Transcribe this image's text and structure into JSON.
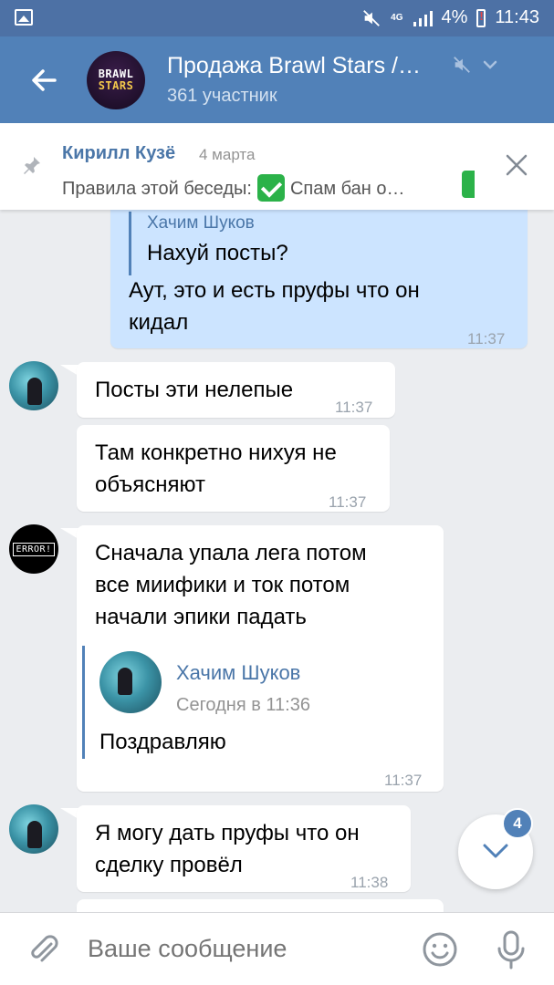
{
  "status_bar": {
    "network": "4G",
    "battery": "4%",
    "time": "11:43"
  },
  "header": {
    "title": "Продажа Brawl Stars /…",
    "subtitle": "361 участник",
    "avatar_logo": [
      "BRAWL",
      "STARS"
    ]
  },
  "pinned": {
    "author": "Кирилл Кузё",
    "date": "4 марта",
    "text_prefix": "Правила этой беседы:",
    "text_suffix": "Спам бан о…"
  },
  "messages": [
    {
      "quote_author": "Хачим Шуков",
      "quote_text": "Нахуй посты?",
      "line1": "Аут, это и есть пруфы что он",
      "line2": "кидал",
      "time": "11:37"
    },
    {
      "text": "Посты эти нелепые",
      "time": "11:37"
    },
    {
      "line1": "Там конкретно нихуя не",
      "line2": "объясняют",
      "time": "11:37"
    },
    {
      "line1": "Сначала упала лега потом",
      "line2": "все миифики и ток потом",
      "line3": "начали эпики падать",
      "quote_author": "Хачим Шуков",
      "quote_date": "Сегодня в 11:36",
      "quote_text": "Поздравляю",
      "time": "11:37",
      "avatar_text": "ERROR!"
    },
    {
      "line1": "Я могу дать пруфы что он",
      "line2": "сделку провёл",
      "time": "11:38"
    }
  ],
  "unread_badge": "4",
  "composer": {
    "placeholder": "Ваше сообщение"
  },
  "colors": {
    "header": "#5181b8",
    "status_bar": "#4d71a5",
    "outgoing_bubble": "#cce4ff",
    "link": "#4a76a8",
    "background": "#ebedf0"
  }
}
